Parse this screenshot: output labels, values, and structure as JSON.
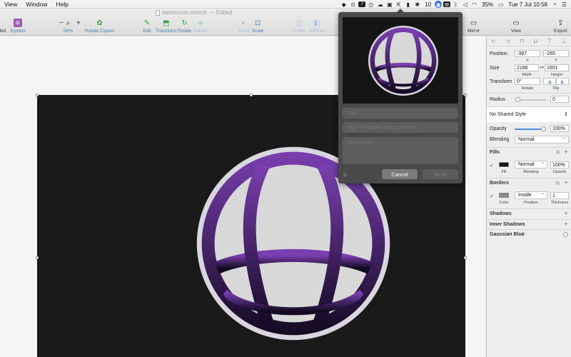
{
  "menubar": {
    "items": [
      "View",
      "Window",
      "Help"
    ],
    "status_icons": [
      "dropbox-icon",
      "app-icon",
      "cal-icon",
      "clock-icon",
      "cloud-icon",
      "box-icon",
      "k-icon",
      "bar-icon",
      "share-icon",
      "battery-monitor-icon",
      "bluetooth-icon",
      "volume-icon",
      "wifi-icon"
    ],
    "lastpass_count": "10",
    "calendar_day": "7",
    "battery_percent": "35%",
    "datetime": "Tue 7 Jul  10:58"
  },
  "toolbar": {
    "doc_name": "swishricon.sketch",
    "doc_state": "— Edited",
    "left_cut_label": "bol",
    "symbol_label": "Symbol",
    "zoom_out": "−",
    "zoom_in": "+",
    "zoom_level": "50%",
    "rotate_copies": "Rotate Copies",
    "edit": "Edit",
    "transform": "Transform",
    "rotate": "Rotate",
    "flatten": "Flatten",
    "mask": "Mask",
    "scale": "Scale",
    "union": "Union",
    "subtract": "Subtract",
    "mirror": "Mirror",
    "view": "View",
    "export": "Export"
  },
  "popover": {
    "title_placeholder": "Title",
    "tags_placeholder": "Tags (separate with commas)",
    "description_placeholder": "Description",
    "cancel_label": "Cancel",
    "send_label": "Send"
  },
  "inspector": {
    "position_label": "Position",
    "pos_x": "-397",
    "pos_y": "-265",
    "x_label": "X",
    "y_label": "Y",
    "size_label": "Size",
    "width": "2166",
    "height": "1651",
    "width_label": "Width",
    "height_label": "Height",
    "transform_label": "Transform",
    "rotate_value": "0°",
    "rotate_label": "Rotate",
    "flip_label": "Flip",
    "radius_label": "Radius",
    "radius_value": "0",
    "shared_style": "No Shared Style",
    "opacity_label": "Opacity",
    "opacity_value": "100%",
    "opacity_fraction": 1.0,
    "blending_label": "Blending",
    "blending_value": "Normal",
    "fills_title": "Fills",
    "fill_color": "#111111",
    "fill_blending": "Normal",
    "fill_opacity": "100%",
    "fill_label": "Fill",
    "fill_blending_label": "Blending",
    "fill_opacity_label": "Opacity",
    "borders_title": "Borders",
    "border_color": "#8a8a8a",
    "border_position": "Inside",
    "border_thickness": "1",
    "border_color_label": "Color",
    "border_position_label": "Position",
    "border_thickness_label": "Thickness",
    "shadows_title": "Shadows",
    "inner_shadows_title": "Inner Shadows",
    "gaussian_blur_title": "Gaussian Blur"
  },
  "colors": {
    "logo_purple_top": "#7a3fb0",
    "logo_purple_bottom": "#140a22",
    "logo_ball": "#d8d8d8",
    "artboard_bg": "#1a1a1a",
    "accent": "#2b6fe0"
  }
}
